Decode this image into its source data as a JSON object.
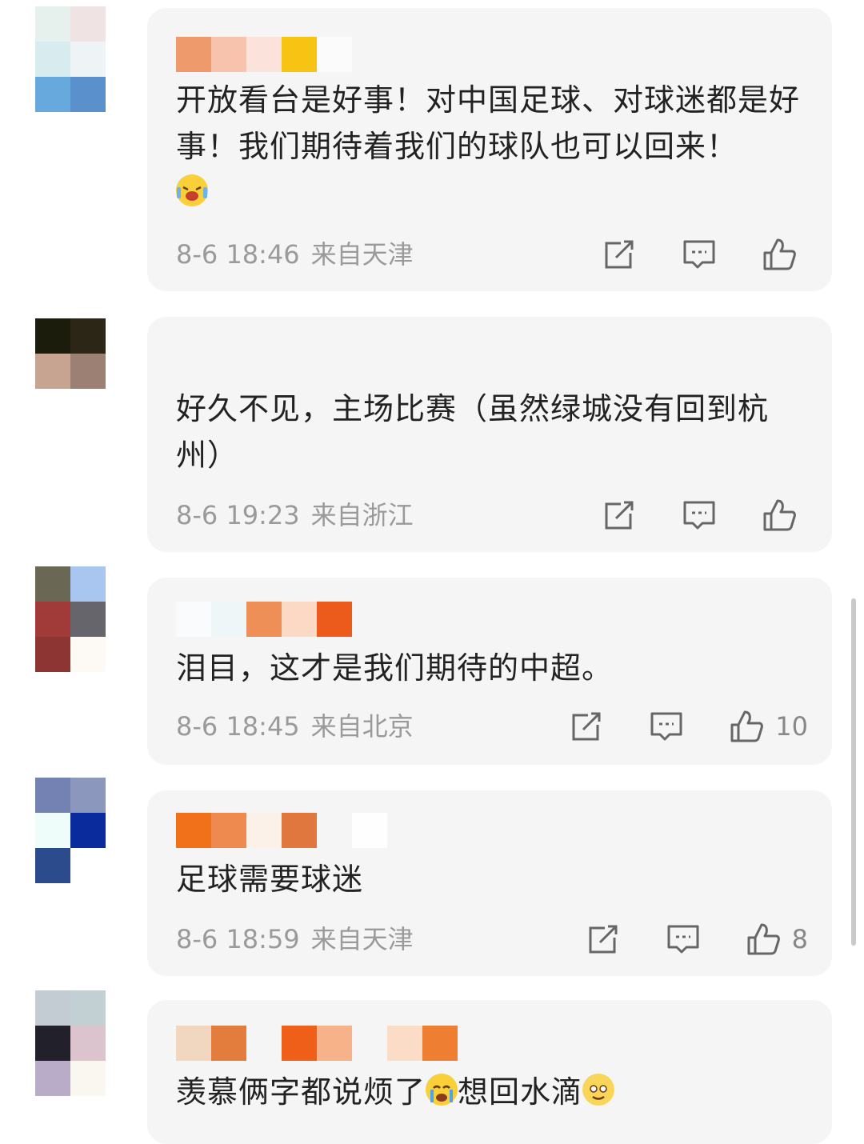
{
  "comments": [
    {
      "text": "开放看台是好事！对中国足球、对球迷都是好事！我们期待着我们的球队也可以回来！",
      "emoji": "laughing-crying-emoji",
      "time": "8-6 18:46",
      "location": "来自天津",
      "likes": ""
    },
    {
      "text": "好久不见，主场比赛（虽然绿城没有回到杭州）",
      "time": "8-6 19:23",
      "location": "来自浙江",
      "likes": ""
    },
    {
      "text": "泪目，这才是我们期待的中超。",
      "time": "8-6 18:45",
      "location": "来自北京",
      "likes": "10"
    },
    {
      "text": "足球需要球迷",
      "time": "8-6 18:59",
      "location": "来自天津",
      "likes": "8"
    },
    {
      "text_before_emoji": "羡慕俩字都说烦了",
      "text_after_emoji": "想回水滴",
      "emojis": [
        "crying-emoji",
        "smiling-emoji"
      ]
    }
  ],
  "icons": {
    "share": "share-icon",
    "reply": "comment-icon",
    "like": "thumbs-up-icon"
  },
  "colors": {
    "card_bg": "#f5f5f5",
    "meta_text": "#9a9a9a"
  }
}
